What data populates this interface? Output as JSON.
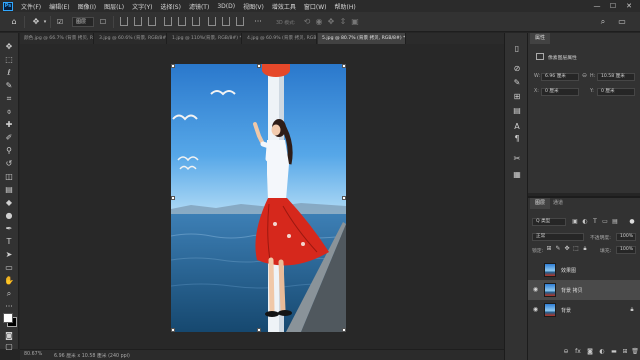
{
  "app": {
    "logo": "Ps",
    "brand_color": "#31a8ff"
  },
  "menu": [
    "文件(F)",
    "编辑(E)",
    "图像(I)",
    "图层(L)",
    "文字(Y)",
    "选择(S)",
    "滤镜(T)",
    "3D(D)",
    "视图(V)",
    "增效工具",
    "窗口(W)",
    "帮助(H)"
  ],
  "window_controls": {
    "minimize": "—",
    "maximize": "☐",
    "close": "✕"
  },
  "options": {
    "auto_select_value": "图层",
    "mode_3d_label": "3D 模式:"
  },
  "tabs": [
    "颜色.jpg @ 66.7% (背景 拷贝, RGB/8#) *",
    "3.jpg @ 60.6% (背景, RGB/8#) *",
    "1.jpg @ 110%(背景, RGB/8#) *",
    "4.jpg @ 60.9% (背景 拷贝, RGB/8#) *",
    "5.jpg @ 80.7% (背景 拷贝, RGB/8#) *"
  ],
  "status": {
    "zoom": "80.67%",
    "doc_size": "6.96 厘米 x 10.58 厘米 (240 ppi)"
  },
  "properties": {
    "tab": "属性",
    "subtitle": "像素图层属性",
    "w_label": "W:",
    "w_value": "6.96 厘米",
    "h_label": "H:",
    "h_value": "10.58 厘米",
    "x_label": "X:",
    "x_value": "0 厘米",
    "y_label": "Y:",
    "y_value": "0 厘米"
  },
  "layers": {
    "tabs": [
      "图层",
      "通道"
    ],
    "filter_label": "Q 类型",
    "blend_mode": "正常",
    "opacity_label": "不透明度:",
    "opacity_value": "100%",
    "lock_label": "锁定:",
    "fill_label": "填充:",
    "fill_value": "100%",
    "items": [
      {
        "name": "效果图",
        "visible": false,
        "selected": false
      },
      {
        "name": "背景 拷贝",
        "visible": true,
        "selected": true
      },
      {
        "name": "背景",
        "visible": true,
        "selected": false
      }
    ]
  }
}
